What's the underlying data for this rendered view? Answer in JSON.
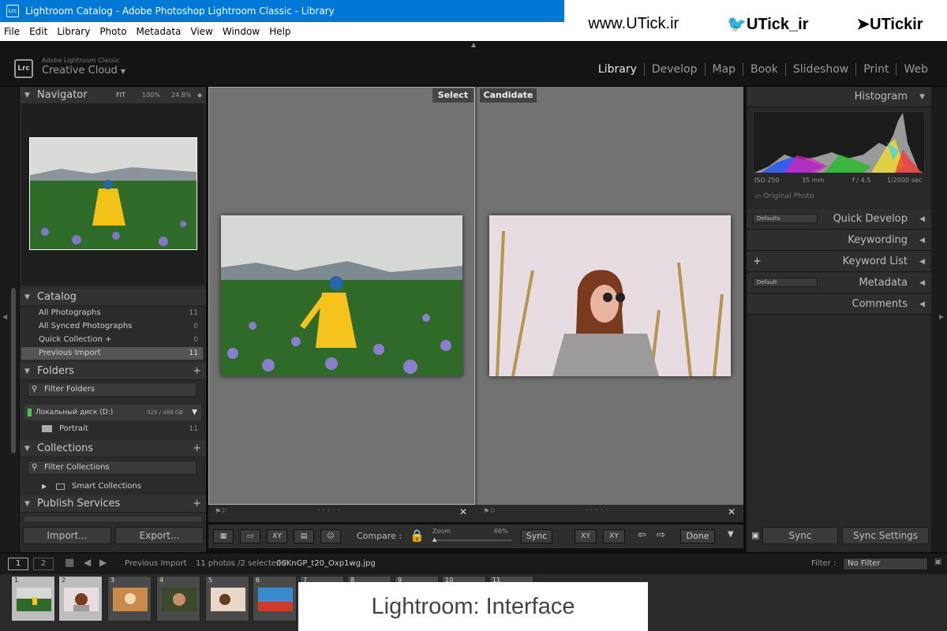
{
  "window": {
    "title": "Lightroom Catalog - Adobe Photoshop Lightroom Classic - Library",
    "icon_label": "Lrc"
  },
  "watermark": {
    "site": "www.UTick.ir",
    "twitter": "UTick_ir",
    "telegram": "UTickir"
  },
  "menu": [
    "File",
    "Edit",
    "Library",
    "Photo",
    "Metadata",
    "View",
    "Window",
    "Help"
  ],
  "identity": {
    "logo": "Lrc",
    "small": "Adobe Lightroom Classic",
    "cc": "Creative Cloud",
    "cc_arrow": "▼"
  },
  "modules": [
    "Library",
    "Develop",
    "Map",
    "Book",
    "Slideshow",
    "Print",
    "Web"
  ],
  "navigator": {
    "title": "Navigator",
    "fit": "FIT",
    "z100": "100%",
    "z248": "24.8%"
  },
  "catalog": {
    "title": "Catalog",
    "items": [
      {
        "label": "All Photographs",
        "count": "11"
      },
      {
        "label": "All Synced Photographs",
        "count": "0"
      },
      {
        "label": "Quick Collection +",
        "count": "0"
      },
      {
        "label": "Previous Import",
        "count": "11"
      }
    ]
  },
  "folders": {
    "title": "Folders",
    "filter": "Filter Folders",
    "drive": "Локальный диск (D:)",
    "drive_space": "329 / 488 GB",
    "folder": "Portrait",
    "folder_count": "11"
  },
  "collections": {
    "title": "Collections",
    "filter": "Filter Collections",
    "smart": "Smart Collections"
  },
  "publish": {
    "title": "Publish Services"
  },
  "left_buttons": {
    "import": "Import...",
    "export": "Export..."
  },
  "compare": {
    "select": "Select",
    "candidate": "Candidate",
    "label": "Compare :",
    "zoom": "Zoom",
    "zoom_val": "66%",
    "sync": "Sync",
    "done": "Done"
  },
  "histogram": {
    "title": "Histogram",
    "iso": "ISO 250",
    "mm": "35 mm",
    "f": "f / 4.5",
    "sec": "1/2000 sec",
    "original": "Original Photo"
  },
  "right_panels": {
    "quick": "Quick Develop",
    "keywording": "Keywording",
    "keywordlist": "Keyword List",
    "metadata": "Metadata",
    "comments": "Comments",
    "defaults": "Defaults",
    "default": "Default"
  },
  "right_buttons": {
    "sync": "Sync",
    "sync_settings": "Sync Settings"
  },
  "filmstrip": {
    "page1": "1",
    "page2": "2",
    "source": "Previous Import",
    "info": "11 photos /2 selected /",
    "file": "06KnGP_t20_Oxp1wg.jpg",
    "filter_label": "Filter :",
    "filter_value": "No Filter",
    "thumb_nums": [
      "1",
      "2",
      "3",
      "4",
      "5",
      "6",
      "7",
      "8",
      "9",
      "10",
      "11"
    ]
  },
  "caption": "Lightroom: Interface"
}
